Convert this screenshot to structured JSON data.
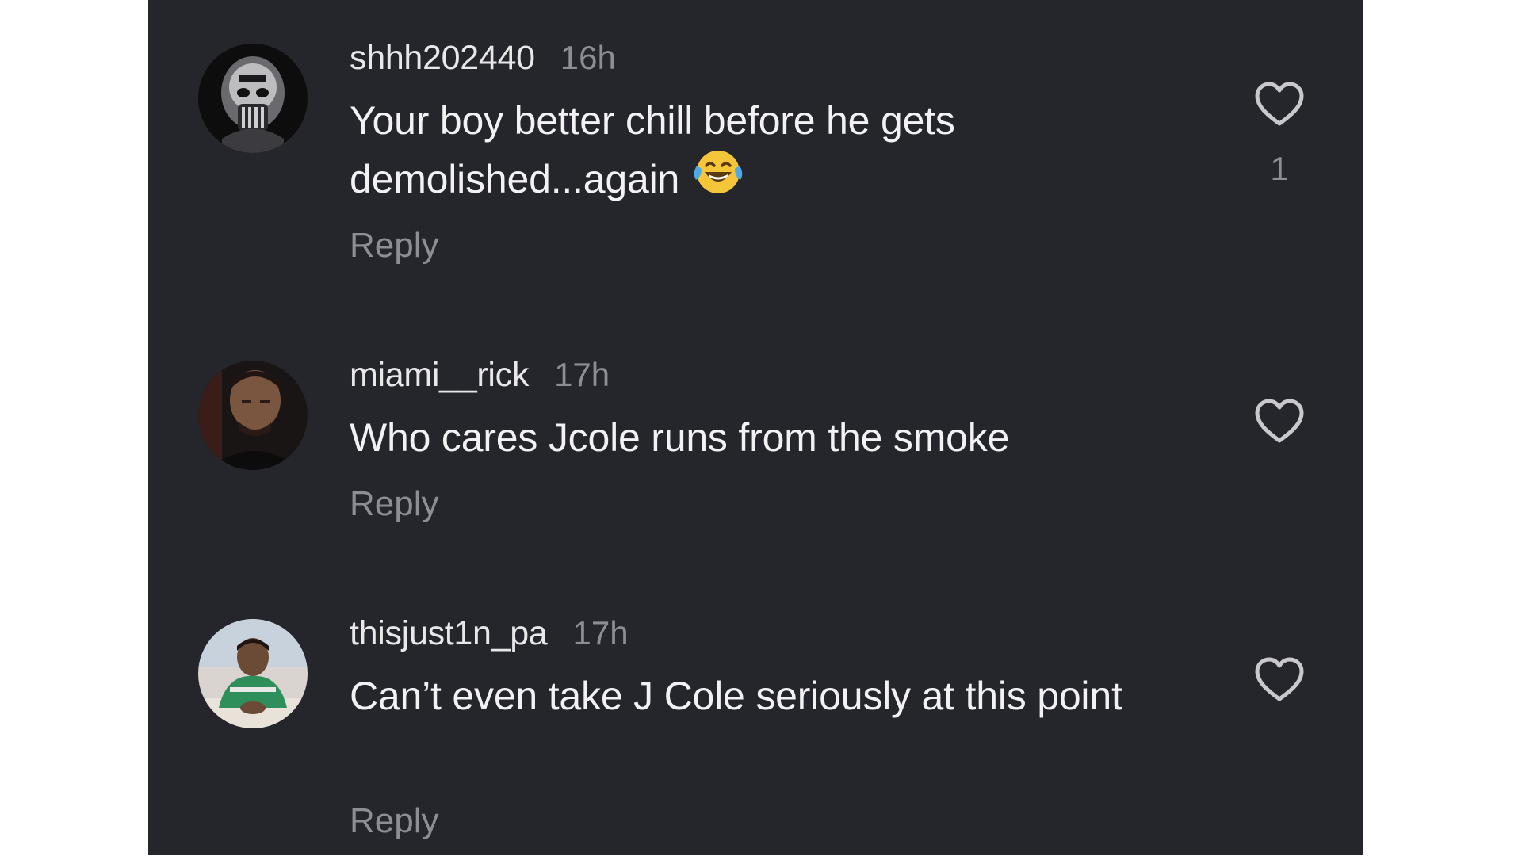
{
  "comments": [
    {
      "username": "shhh202440",
      "time": "16h",
      "text": "Your boy better chill before he gets demolished...again",
      "emoji": "face-with-tears-of-joy-icon",
      "reply_label": "Reply",
      "like_count": "1"
    },
    {
      "username": "miami__rick",
      "time": "17h",
      "text": "Who cares Jcole runs from the smoke",
      "reply_label": "Reply",
      "like_count": ""
    },
    {
      "username": "thisjust1n_pa",
      "time": "17h",
      "text": "Can’t even take J Cole seriously at this point",
      "reply_label": "Reply",
      "like_count": ""
    }
  ],
  "colors": {
    "background": "#25262c",
    "username": "#e8e8ea",
    "muted": "#8d8e95",
    "text": "#f2f2f4"
  },
  "icons": {
    "like": "heart-outline-icon"
  }
}
